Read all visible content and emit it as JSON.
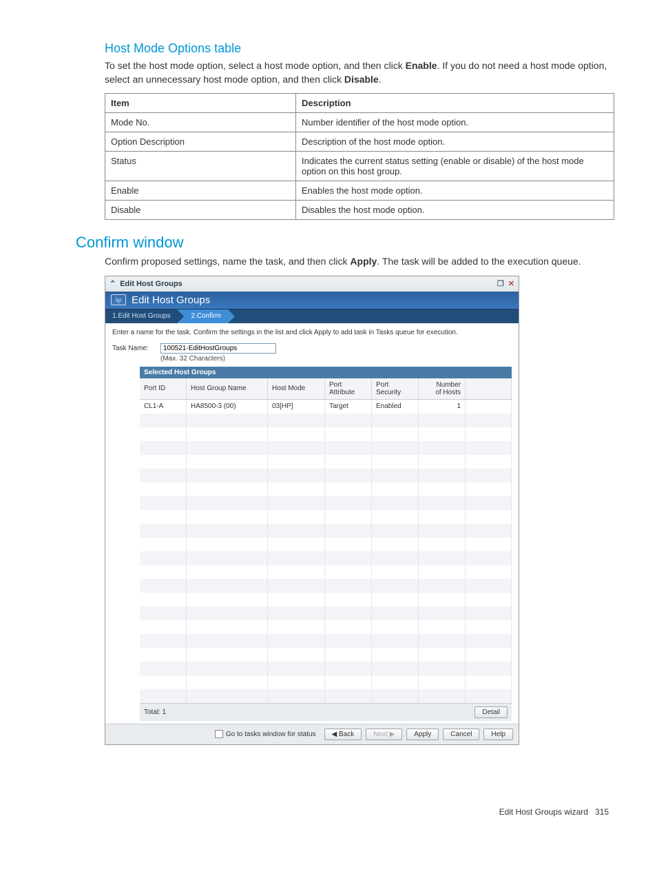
{
  "doc": {
    "subheading": "Host Mode Options table",
    "para1_prefix": "To set the host mode option, select a host mode option, and then click ",
    "para1_bold1": "Enable",
    "para1_middle": ". If you do not need a host mode option, select an unnecessary host mode option, and then click ",
    "para1_bold2": "Disable",
    "para1_suffix": ".",
    "table_headers": {
      "c1": "Item",
      "c2": "Description"
    },
    "table_rows": [
      {
        "c1": "Mode No.",
        "c2": "Number identifier of the host mode option."
      },
      {
        "c1": "Option Description",
        "c2": "Description of the host mode option."
      },
      {
        "c1": "Status",
        "c2": "Indicates the current status setting (enable or disable) of the host mode option on this host group."
      },
      {
        "c1": "Enable",
        "c2": "Enables the host mode option."
      },
      {
        "c1": "Disable",
        "c2": "Disables the host mode option."
      }
    ],
    "section": "Confirm window",
    "para2_prefix": "Confirm proposed settings, name the task, and then click ",
    "para2_bold": "Apply",
    "para2_suffix": ". The task will be added to the execution queue."
  },
  "wnd": {
    "title": "Edit Host Groups",
    "band_title": "Edit Host Groups",
    "tabs": {
      "step1": "1.Edit Host Groups",
      "step2": "2.Confirm"
    },
    "instruction": "Enter a name for the task. Confirm the settings in the list and click Apply to add task in Tasks queue for execution.",
    "task_label": "Task Name:",
    "task_value": "100521-EditHostGroups",
    "task_hint": "(Max. 32 Characters)",
    "selected_header": "Selected Host Groups",
    "columns": {
      "port_id": "Port ID",
      "hg_name": "Host Group Name",
      "host_mode": "Host Mode",
      "port_attr_l1": "Port",
      "port_attr_l2": "Attribute",
      "port_sec_l1": "Port",
      "port_sec_l2": "Security",
      "num_hosts_l1": "Number",
      "num_hosts_l2": "of Hosts"
    },
    "row": {
      "port_id": "CL1-A",
      "hg_name": "HA8500-3 (00)",
      "host_mode": "03[HP]",
      "port_attr": "Target",
      "port_sec": "Enabled",
      "num_hosts": "1"
    },
    "total_label": "Total: 1",
    "detail_btn": "Detail",
    "checkbox_label": "Go to tasks window for status",
    "buttons": {
      "back": "◀ Back",
      "next": "Next ▶",
      "apply": "Apply",
      "cancel": "Cancel",
      "help": "Help"
    }
  },
  "footer": {
    "text": "Edit Host Groups wizard",
    "page": "315"
  }
}
